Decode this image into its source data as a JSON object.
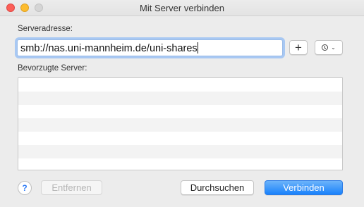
{
  "window": {
    "title": "Mit Server verbinden"
  },
  "server_address": {
    "label": "Serveradresse:",
    "value": "smb://nas.uni-mannheim.de/uni-shares"
  },
  "toolbar": {
    "add_label": "+",
    "recent_icon": "clock-icon",
    "recent_chevron": "⌄"
  },
  "favorites": {
    "label": "Bevorzugte Server:",
    "rows": [
      "",
      "",
      "",
      "",
      "",
      "",
      ""
    ]
  },
  "buttons": {
    "help_label": "?",
    "remove_label": "Entfernen",
    "browse_label": "Durchsuchen",
    "connect_label": "Verbinden"
  },
  "colors": {
    "accent": "#1a82fb",
    "focus_ring": "#a8c8f3",
    "close": "#fc5f57",
    "minimize": "#fdbc2e",
    "zoom_disabled": "#d5d5d5"
  }
}
